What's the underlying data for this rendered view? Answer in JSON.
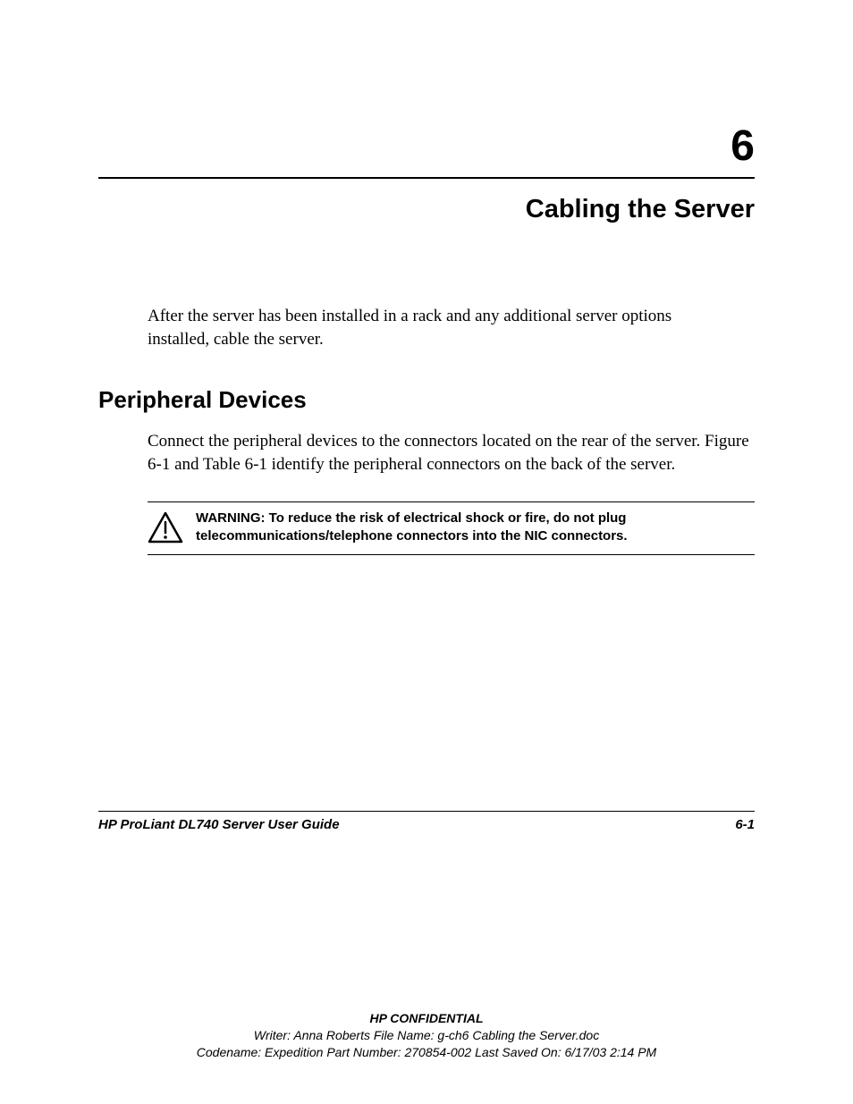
{
  "chapter": {
    "number": "6",
    "title": "Cabling the Server"
  },
  "intro": "After the server has been installed in a rack and any additional server options installed, cable the server.",
  "section": {
    "heading": "Peripheral Devices",
    "body": "Connect the peripheral devices to the connectors located on the rear of the server. Figure 6-1 and Table 6-1 identify the peripheral connectors on the back of the server."
  },
  "warning": {
    "label": "WARNING:",
    "text": "To reduce the risk of electrical shock or fire, do not plug telecommunications/telephone connectors into the NIC connectors."
  },
  "footer": {
    "guide": "HP ProLiant DL740 Server User Guide",
    "page": "6-1",
    "confidential": "HP CONFIDENTIAL",
    "writer": "Writer: Anna Roberts File Name: g-ch6 Cabling the Server.doc",
    "codename": "Codename: Expedition Part Number: 270854-002 Last Saved On: 6/17/03 2:14 PM"
  }
}
